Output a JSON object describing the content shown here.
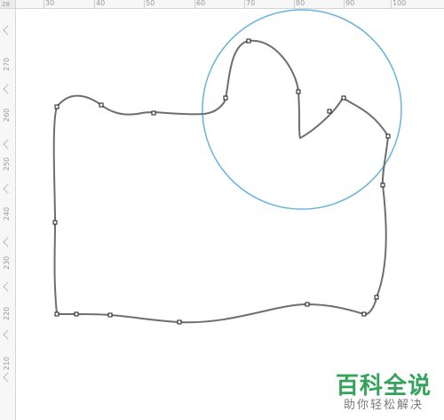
{
  "rulers": {
    "top_labels": [
      "30",
      "40",
      "50",
      "60",
      "70",
      "80",
      "90",
      "100"
    ],
    "left_labels": [
      "270",
      "260",
      "250",
      "240",
      "230",
      "220",
      "210"
    ],
    "corner_label": "28"
  },
  "canvas": {
    "curve_color": "#6e6e6e",
    "circle_color": "#67b4d9",
    "node_color": "#1a1a1a",
    "background": "#ffffff"
  },
  "watermark": {
    "title": "百科全说",
    "subtitle": "助你轻松解决",
    "color": "#33a35b"
  }
}
